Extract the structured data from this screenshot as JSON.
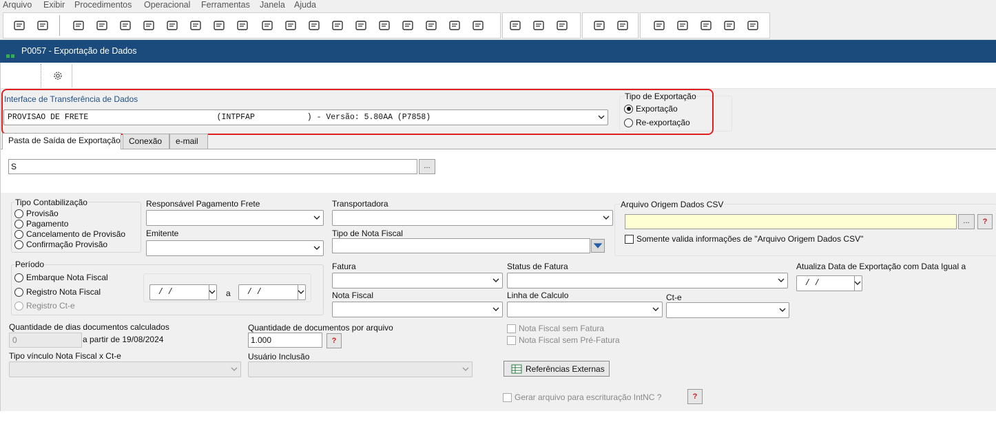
{
  "menu": [
    "Arquivo",
    "Exibir",
    "Procedimentos",
    "Operacional",
    "Ferramentas",
    "Janela",
    "Ajuda"
  ],
  "window_title": "P0057 - Exportação de Dados",
  "interface": {
    "label": "Interface de Transferência de Dados",
    "value": "PROVISAO DE FRETE                           (INTPFAP           ) - Versão: 5.80AA (P7858)"
  },
  "tipo_exportacao": {
    "label": "Tipo de Exportação",
    "options": [
      "Exportação",
      "Re-exportação"
    ],
    "selected": "Exportação"
  },
  "tabs": [
    "Pasta de Saída de Exportação",
    "Conexão",
    "e-mail"
  ],
  "active_tab": "Pasta de Saída de Exportação",
  "pasta": {
    "value": "S",
    "browse": "..."
  },
  "tipo_contabilizacao": {
    "label": "Tipo Contabilização",
    "options": [
      "Provisão",
      "Pagamento",
      "Cancelamento de Provisão",
      "Confirmação Provisão"
    ]
  },
  "responsavel": {
    "label": "Responsável Pagamento Frete"
  },
  "emitente": {
    "label": "Emitente"
  },
  "transportadora": {
    "label": "Transportadora"
  },
  "tipo_nf": {
    "label": "Tipo de Nota Fiscal"
  },
  "arquivo_csv": {
    "label": "Arquivo Origem Dados CSV",
    "browse": "...",
    "help": "?",
    "check_label": "Somente valida informações de \"Arquivo Origem Dados CSV\""
  },
  "periodo": {
    "label": "Período",
    "options": [
      "Embarque Nota Fiscal",
      "Registro Nota Fiscal",
      "Registro Ct-e"
    ],
    "from": " / /",
    "to": " / /",
    "between": "a"
  },
  "fatura": {
    "label": "Fatura"
  },
  "status_fatura": {
    "label": "Status de Fatura"
  },
  "atualiza_data": {
    "label": "Atualiza Data de Exportação com Data Igual a",
    "value": " / /"
  },
  "nota_fiscal": {
    "label": "Nota Fiscal"
  },
  "linha_calculo": {
    "label": "Linha de Calculo"
  },
  "cte": {
    "label": "Ct-e"
  },
  "qtd_dias": {
    "label": "Quantidade de dias documentos calculados",
    "value": "0",
    "suffix": "a partir de 19/08/2024"
  },
  "qtd_docs": {
    "label": "Quantidade de documentos por arquivo",
    "value": "1.000",
    "help": "?"
  },
  "nf_sem_fatura": "Nota Fiscal sem Fatura",
  "nf_sem_prefatura": "Nota Fiscal sem Pré-Fatura",
  "tipo_vinculo": {
    "label": "Tipo vínculo Nota Fiscal x Ct-e"
  },
  "usuario_inclusao": {
    "label": "Usuário Inclusão"
  },
  "referencias_btn": "Referências Externas",
  "gerar_arquivo": {
    "label": "Gerar arquivo para escrituração IntNC ?",
    "help": "?"
  },
  "colors": {
    "title_bar": "#1b4b7c",
    "highlight": "#e02020",
    "csv_field": "#ffffd4"
  }
}
